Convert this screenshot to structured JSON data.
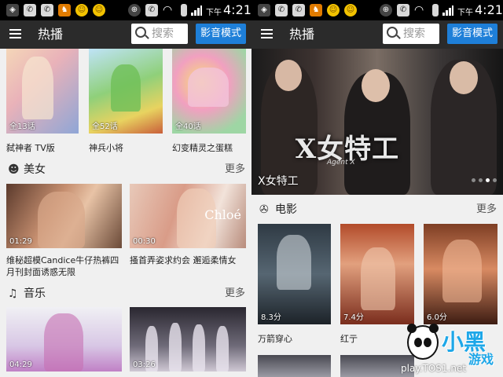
{
  "statusbar": {
    "ampm": "下午",
    "time": "4:21"
  },
  "header": {
    "title": "热播",
    "search_placeholder": "搜索",
    "media_mode_label": "影音模式"
  },
  "left": {
    "top_row": [
      {
        "badge": "全13话",
        "caption": "弑神者 TV版"
      },
      {
        "badge": "全52话",
        "caption": "神兵小将"
      },
      {
        "badge": "全40话",
        "caption": "幻变精灵之蛋糕"
      }
    ],
    "sections": [
      {
        "title": "美女",
        "icon": "female-icon",
        "more": "更多",
        "items": [
          {
            "duration": "01:29",
            "caption": "维秘超模Candice牛仔热裤四月刊封面诱惑无限"
          },
          {
            "duration": "00:30",
            "caption": "搔首弄姿求约会 邂逅柔情女",
            "overlay_text": "Chloé"
          }
        ]
      },
      {
        "title": "音乐",
        "icon": "music-note-icon",
        "more": "更多",
        "items": [
          {
            "duration": "04:29"
          },
          {
            "duration": "03:26"
          }
        ]
      }
    ]
  },
  "right": {
    "hero": {
      "title": "X女特工",
      "logo_text": "X女特工",
      "logo_sub": "Agent X",
      "dots": 4,
      "active_dot": 2
    },
    "section": {
      "title": "电影",
      "icon": "film-reel-icon",
      "more": "更多",
      "items": [
        {
          "rating": "8.3分",
          "caption": "万箭穿心"
        },
        {
          "rating": "7.4分",
          "caption": "红亍"
        },
        {
          "rating": "6.0分",
          "caption": ""
        }
      ]
    }
  },
  "watermark": {
    "text": "小黑",
    "text2": "游戏",
    "url": "play.TOS1.net"
  }
}
